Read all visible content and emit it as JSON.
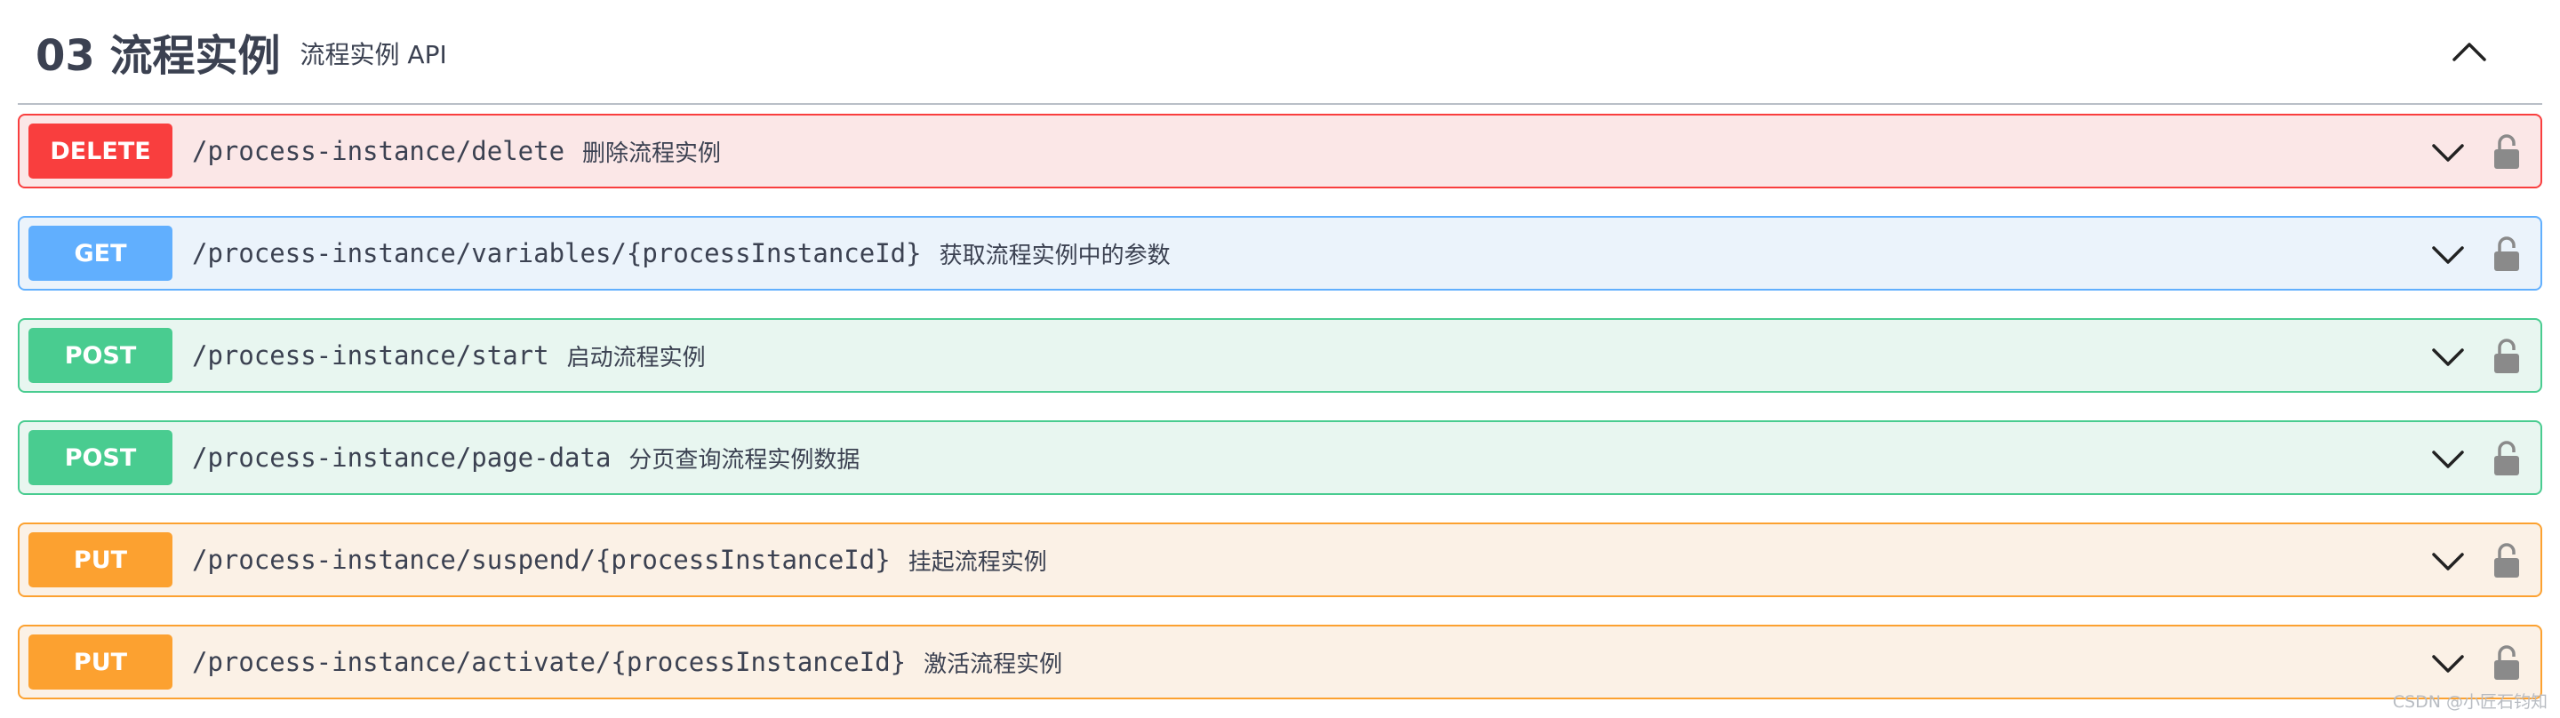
{
  "section": {
    "title": "03 流程实例",
    "description": "流程实例 API",
    "toggle_icon": "chevron-up-icon"
  },
  "operations": [
    {
      "method": "DELETE",
      "path": "/process-instance/delete",
      "summary": "删除流程实例",
      "color": "#f93e3e"
    },
    {
      "method": "GET",
      "path": "/process-instance/variables/{processInstanceId}",
      "summary": "获取流程实例中的参数",
      "color": "#61affe"
    },
    {
      "method": "POST",
      "path": "/process-instance/start",
      "summary": "启动流程实例",
      "color": "#49cc90"
    },
    {
      "method": "POST",
      "path": "/process-instance/page-data",
      "summary": "分页查询流程实例数据",
      "color": "#49cc90"
    },
    {
      "method": "PUT",
      "path": "/process-instance/suspend/{processInstanceId}",
      "summary": "挂起流程实例",
      "color": "#fca130"
    },
    {
      "method": "PUT",
      "path": "/process-instance/activate/{processInstanceId}",
      "summary": "激活流程实例",
      "color": "#fca130"
    }
  ],
  "icons": {
    "expand": "chevron-down-icon",
    "auth": "lock-icon"
  },
  "watermark": "CSDN @小匠石钧知"
}
